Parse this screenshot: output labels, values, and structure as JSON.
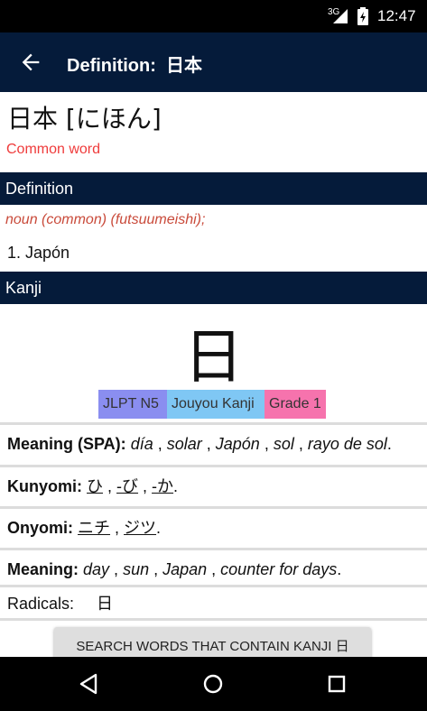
{
  "status_bar": {
    "network": "3G",
    "time": "12:47"
  },
  "app_bar": {
    "title": "Definition:  日本"
  },
  "entry": {
    "word": "日本 [にほん]",
    "common_label": "Common word"
  },
  "definition_section": {
    "header": "Definition",
    "part_of_speech": "noun (common) (futsuumeishi);",
    "gloss": "1. Japón"
  },
  "kanji_section": {
    "header": "Kanji",
    "kanji": "日",
    "badges": {
      "jlpt": "JLPT N5",
      "jouyou": "Jouyou Kanji",
      "grade": "Grade 1"
    },
    "meaning_spa": {
      "label": "Meaning (SPA):",
      "items": [
        "día",
        "solar",
        "Japón",
        "sol",
        "rayo de sol"
      ]
    },
    "kunyomi": {
      "label": "Kunyomi:",
      "items": [
        "ひ",
        "-び",
        "-か"
      ]
    },
    "onyomi": {
      "label": "Onyomi:",
      "items": [
        "ニチ",
        "ジツ"
      ]
    },
    "meaning": {
      "label": "Meaning:",
      "items": [
        "day",
        "sun",
        "Japan",
        "counter for days"
      ]
    },
    "radicals": {
      "label": "Radicals:",
      "value": "日"
    },
    "search_button": "SEARCH WORDS THAT CONTAIN KANJI 日"
  },
  "icons": [
    "back-arrow-icon",
    "signal-icon",
    "battery-icon",
    "nav-back-icon",
    "nav-home-icon",
    "nav-recents-icon"
  ]
}
